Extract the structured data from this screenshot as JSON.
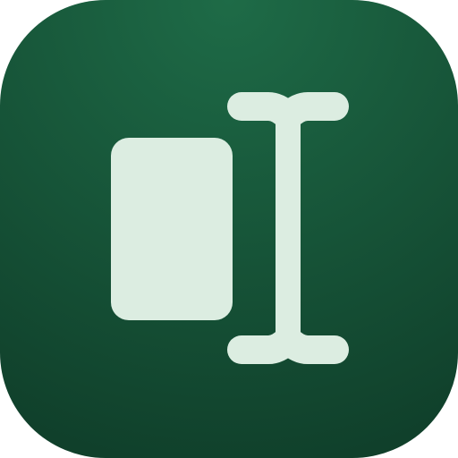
{
  "app_icon": {
    "icon": "text-cursor-beside-block-icon",
    "background_color_light": "#1e6b47",
    "background_color_dark": "#0f3d29",
    "glyph_color": "#dcede1"
  }
}
